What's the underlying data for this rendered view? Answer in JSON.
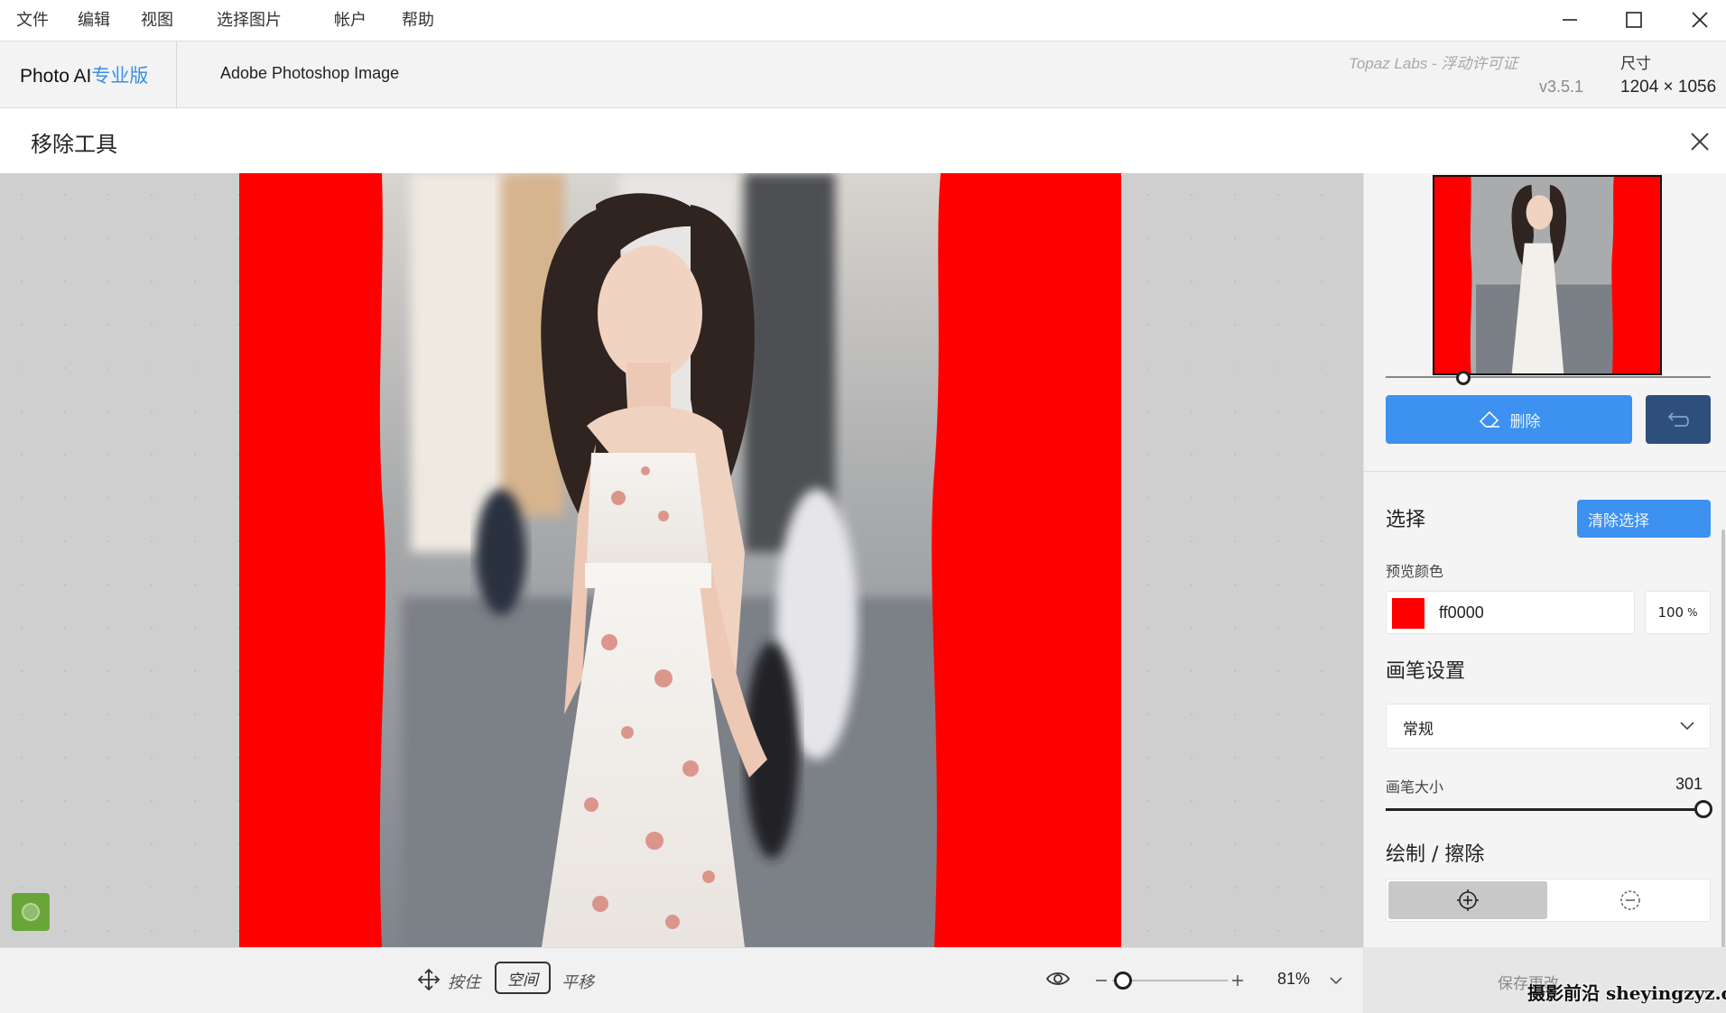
{
  "menu": {
    "items": [
      "文件",
      "编辑",
      "视图",
      "选择图片",
      "帐户",
      "帮助"
    ]
  },
  "header": {
    "brand": "Photo AI",
    "brand_edition": "专业版",
    "document_title": "Adobe Photoshop Image",
    "license": "Topaz Labs - 浮动许可证",
    "version": "v3.5.1",
    "dimensions_label": "尺寸",
    "dimensions_value": "1204 × 1056"
  },
  "tool": {
    "title": "移除工具"
  },
  "bottom_bar": {
    "hint_hold": "按住",
    "hint_key": "空间",
    "hint_action": "平移",
    "zoom_value": "81%",
    "zoom_level": 0.81
  },
  "panel": {
    "delete_label": "删除",
    "selection_title": "选择",
    "clear_selection_label": "清除选择",
    "preview_color_label": "预览颜色",
    "preview_color_hex": "ff0000",
    "preview_opacity": "100",
    "preview_opacity_unit": "%",
    "brush_settings_title": "画笔设置",
    "brush_mode_value": "常规",
    "brush_size_label": "画笔大小",
    "brush_size_value": "301",
    "draw_erase_title": "绘制 / 擦除",
    "save_label": "保存更改"
  },
  "watermark": "摄影前沿 sheyingzyz.com",
  "colors": {
    "accent": "#3d91f0",
    "mask": "#ff0000",
    "undo": "#2e4e7c"
  }
}
